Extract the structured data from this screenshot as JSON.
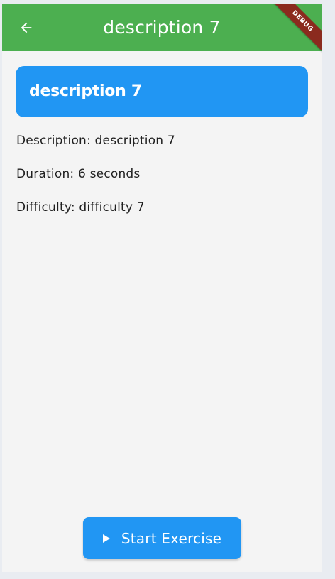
{
  "appbar": {
    "title": "description 7",
    "back_icon": "arrow-left-icon",
    "color": "#4caf50",
    "debug_label": "DEBUG"
  },
  "card": {
    "title": "description 7",
    "color": "#2196f3"
  },
  "details": {
    "description": "Description: description 7",
    "duration": "Duration: 6 seconds",
    "difficulty": "Difficulty: difficulty 7"
  },
  "actions": {
    "start_label": "Start Exercise",
    "start_icon": "play-icon"
  }
}
